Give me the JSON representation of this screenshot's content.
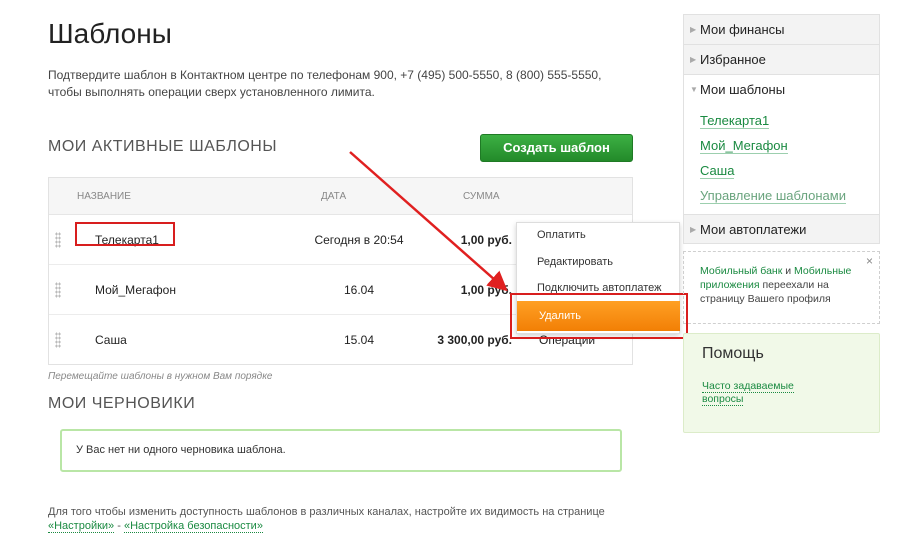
{
  "page": {
    "title": "Шаблоны",
    "intro": "Подтвердите шаблон в Контактном центре по телефонам 900, +7 (495) 500-5550, 8 (800) 555-5550, чтобы выполнять операции сверх установленного лимита."
  },
  "active": {
    "title": "МОИ АКТИВНЫЕ ШАБЛОНЫ",
    "create_button": "Создать шаблон",
    "columns": {
      "name": "НАЗВАНИЕ",
      "date": "ДАТА",
      "sum": "СУММА"
    },
    "rows": [
      {
        "name": "Телекарта1",
        "date": "Сегодня в 20:54",
        "sum": "1,00 руб.",
        "ops": ""
      },
      {
        "name": "Мой_Мегафон",
        "date": "16.04",
        "sum": "1,00 руб.",
        "ops": ""
      },
      {
        "name": "Саша",
        "date": "15.04",
        "sum": "3 300,00 руб.",
        "ops": "Операции"
      }
    ],
    "dropdown": {
      "pay": "Оплатить",
      "edit": "Редактировать",
      "autopay": "Подключить автоплатеж",
      "delete": "Удалить"
    },
    "hint": "Перемещайте шаблоны в нужном Вам порядке"
  },
  "drafts": {
    "title": "МОИ ЧЕРНОВИКИ",
    "empty_text": "У Вас нет ни одного черновика шаблона."
  },
  "footer": {
    "text": "Для того чтобы изменить доступность шаблонов в различных каналах, настройте их видимость на странице",
    "link1": "«Настройки»",
    "sep": " - ",
    "link2": "«Настройка безопасности»"
  },
  "sidebar": {
    "items": [
      {
        "label": "Мои финансы"
      },
      {
        "label": "Избранное"
      },
      {
        "label": "Мои шаблоны"
      },
      {
        "label": "Мои автоплатежи"
      }
    ],
    "open_icon": "▼",
    "closed_icon": "▶",
    "templates_sub": [
      "Телекарта1",
      "Мой_Мегафон",
      "Саша",
      "Управление шаблонами"
    ]
  },
  "notice": {
    "link1": "Мобильный банк",
    "and": " и ",
    "link2": "Мобильные приложения",
    "text": " переехали на страницу Вашего профиля",
    "close": "×"
  },
  "help": {
    "title": "Помощь",
    "faq": "Часто задаваемые вопросы"
  },
  "colors": {
    "accent_green": "#238a2a",
    "link_green": "#1a8a41",
    "highlight_red": "#d81e1e",
    "delete_orange": "#f27f05"
  }
}
